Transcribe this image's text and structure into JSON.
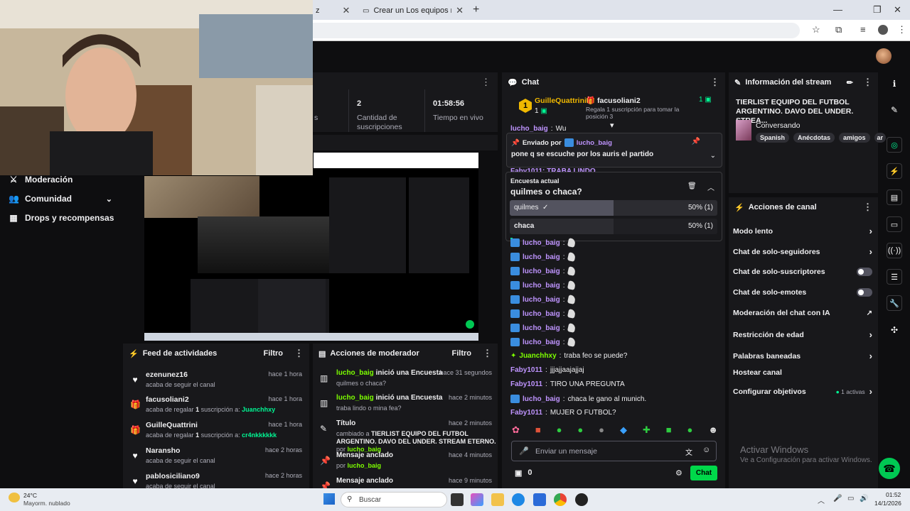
{
  "browser": {
    "tab1_title": "Crear un Los equipos más gran",
    "tab_partial": "z"
  },
  "left_nav": [
    {
      "label": "Moderación",
      "icon": "sword-icon"
    },
    {
      "label": "Comunidad",
      "icon": "people-icon"
    },
    {
      "label": "Drops y recompensas",
      "icon": "drops-icon"
    }
  ],
  "stats": [
    {
      "value": "",
      "label": "s"
    },
    {
      "value": "2",
      "label": "Cantidad de suscripciones"
    },
    {
      "value": "01:58:56",
      "label": "Tiempo en vivo"
    }
  ],
  "feed": {
    "title": "Feed de actividades",
    "filter": "Filtro",
    "items": [
      {
        "name": "ezenunez16",
        "time": "hace 1 hora",
        "sub": "acaba de seguir el canal",
        "icon": "heart-icon",
        "highlight": ""
      },
      {
        "name": "facusoliani2",
        "time": "hace 1 hora",
        "sub": "acaba de regalar ",
        "count": "1",
        "sub2": " suscripción a: ",
        "highlight": "Juanchhxy",
        "icon": "gift-icon"
      },
      {
        "name": "GuilleQuattrini",
        "time": "hace 1 hora",
        "sub": "acaba de regalar ",
        "count": "1",
        "sub2": " suscripción a: ",
        "highlight": "cr4nkkkkkk",
        "icon": "gift-icon"
      },
      {
        "name": "Naransho",
        "time": "hace 2 horas",
        "sub": "acaba de seguir el canal",
        "icon": "heart-icon",
        "highlight": ""
      },
      {
        "name": "pablosiciliano9",
        "time": "hace 2 horas",
        "sub": "acaba de seguir el canal",
        "icon": "heart-icon",
        "highlight": ""
      }
    ]
  },
  "mod": {
    "title": "Acciones de moderador",
    "filter": "Filtro",
    "items": [
      {
        "user": "lucho_baig",
        "action": " inició una Encuesta",
        "time": "hace 31 segundos",
        "sub": "quilmes o chaca?"
      },
      {
        "user": "lucho_baig",
        "action": " inició una Encuesta",
        "time": "hace 2 minutos",
        "sub": "traba lindo o mina fea?"
      },
      {
        "title": "Título",
        "time": "hace 2 minutos",
        "sub_pre": "cambiado a ",
        "sub_bold": "TIERLIST EQUIPO DEL FUTBOL ARGENTINO. DAVO DEL UNDER. STREAM ETERNO.",
        "sub_por": " por ",
        "sub_user": "lucho_baig"
      },
      {
        "title": "Mensaje anclado",
        "time": "hace 4 minutos",
        "sub_por": "por ",
        "sub_user": "lucho_baig"
      },
      {
        "title": "Mensaje anclado",
        "time": "hace 9 minutos"
      }
    ]
  },
  "chat": {
    "title": "Chat",
    "leader": {
      "rank": "1",
      "name": "GuilleQuattrini",
      "count": "1"
    },
    "gifter": {
      "name": "facusoliani2",
      "text": "Regala 1 suscripción para tomar la posición 3",
      "count": "1"
    },
    "pinned": {
      "label": "Enviado por",
      "user": "lucho_baig",
      "message": "pone q se escuche por los auris el partido"
    },
    "poll": {
      "label": "Encuesta actual",
      "question": "quilmes o chaca?",
      "options": [
        {
          "name": "quilmes",
          "pct": "50% (1)",
          "fraction": 0.5,
          "selected": true
        },
        {
          "name": "chaca",
          "pct": "50% (1)",
          "fraction": 0.5,
          "selected": false
        }
      ]
    },
    "partial_top": {
      "user": "lucho_baig",
      "msg": "Wu"
    },
    "partial_2": "Faby1011: TRABA LINDO",
    "messages": [
      {
        "user": "lucho_baig",
        "msg": "",
        "color": "#bf94ff",
        "badge": true
      },
      {
        "user": "lucho_baig",
        "msg": "",
        "color": "#bf94ff",
        "badge": true
      },
      {
        "user": "lucho_baig",
        "msg": "",
        "color": "#bf94ff",
        "badge": true
      },
      {
        "user": "lucho_baig",
        "msg": "",
        "color": "#bf94ff",
        "badge": true
      },
      {
        "user": "lucho_baig",
        "msg": "",
        "color": "#bf94ff",
        "badge": true
      },
      {
        "user": "lucho_baig",
        "msg": "",
        "color": "#bf94ff",
        "badge": true
      },
      {
        "user": "lucho_baig",
        "msg": "",
        "color": "#bf94ff",
        "badge": true
      },
      {
        "user": "lucho_baig",
        "msg": "",
        "color": "#bf94ff",
        "badge": true
      },
      {
        "user": "Juanchhxy",
        "msg": "traba feo se puede?",
        "color": "#7dff00",
        "badge": false
      },
      {
        "user": "Faby1011",
        "msg": "jjjajjaajajjaj",
        "color": "#bf94ff",
        "badge": false
      },
      {
        "user": "Faby1011",
        "msg": "TIRO UNA PREGUNTA",
        "color": "#bf94ff",
        "badge": false
      },
      {
        "user": "lucho_baig",
        "msg": "chaca le gano al munich.",
        "color": "#bf94ff",
        "badge": true
      },
      {
        "user": "Faby1011",
        "msg": "MUJER O FUTBOL?",
        "color": "#bf94ff",
        "badge": false
      }
    ],
    "input_placeholder": "Enviar un mensaje",
    "points": "0",
    "send": "Chat"
  },
  "stream_info": {
    "title": "Información del stream",
    "stream_title": "TIERLIST EQUIPO DEL FUTBOL ARGENTINO. DAVO DEL UNDER. STREA...",
    "category": "Conversando",
    "tags": [
      "Spanish",
      "Anécdotas",
      "amigos",
      "ar"
    ]
  },
  "channel_actions": {
    "title": "Acciones de canal",
    "items": [
      {
        "label": "Modo lento",
        "control": "chevron"
      },
      {
        "label": "Chat de solo-seguidores",
        "control": "chevron"
      },
      {
        "label": "Chat de solo-suscriptores",
        "control": "toggle"
      },
      {
        "label": "Chat de solo-emotes",
        "control": "toggle"
      },
      {
        "label": "Moderación del chat con IA",
        "control": "external"
      },
      {
        "label": "Restricción de edad",
        "control": "chevron"
      },
      {
        "label": "Palabras baneadas",
        "control": "chevron"
      },
      {
        "label": "Hostear canal",
        "control": "none"
      },
      {
        "label": "Configurar objetivos",
        "control": "chevron",
        "extra": "1 activas"
      }
    ]
  },
  "watermark": {
    "line1": "Activar Windows",
    "line2": "Ve a Configuración para activar Windows."
  },
  "taskbar": {
    "temp": "24°C",
    "weather": "Mayorm. nublado",
    "search": "Buscar",
    "time": "01:52",
    "date": "14/1/2026"
  },
  "colors": {
    "accent": "#9147ff",
    "green": "#00f593",
    "lime": "#7dff00",
    "twitch_purple": "#bf94ff"
  }
}
